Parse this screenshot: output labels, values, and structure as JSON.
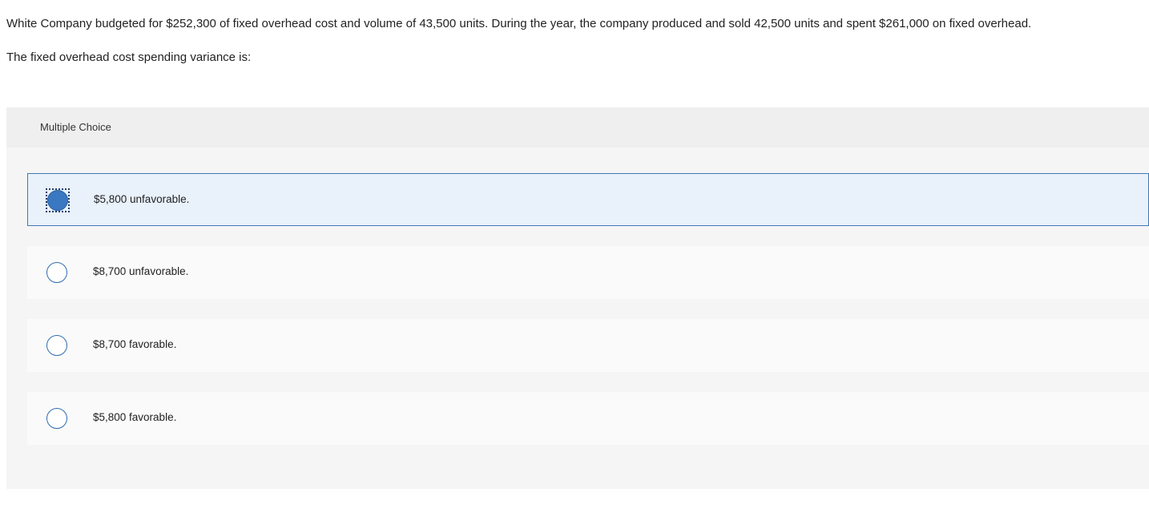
{
  "question": {
    "text": "White Company budgeted for $252,300 of fixed overhead cost and volume of 43,500 units. During the year, the company produced and sold 42,500 units and spent $261,000 on fixed overhead.",
    "prompt": "The fixed overhead cost spending variance is:"
  },
  "multiple_choice": {
    "header": "Multiple Choice",
    "selected_index": 0,
    "options": [
      {
        "label": "$5,800 unfavorable."
      },
      {
        "label": "$8,700 unfavorable."
      },
      {
        "label": "$8,700 favorable."
      },
      {
        "label": "$5,800 favorable."
      }
    ]
  },
  "colors": {
    "accent": "#3a78c2",
    "selected_bg": "#e9f1fa",
    "panel_bg": "#f5f5f5"
  }
}
